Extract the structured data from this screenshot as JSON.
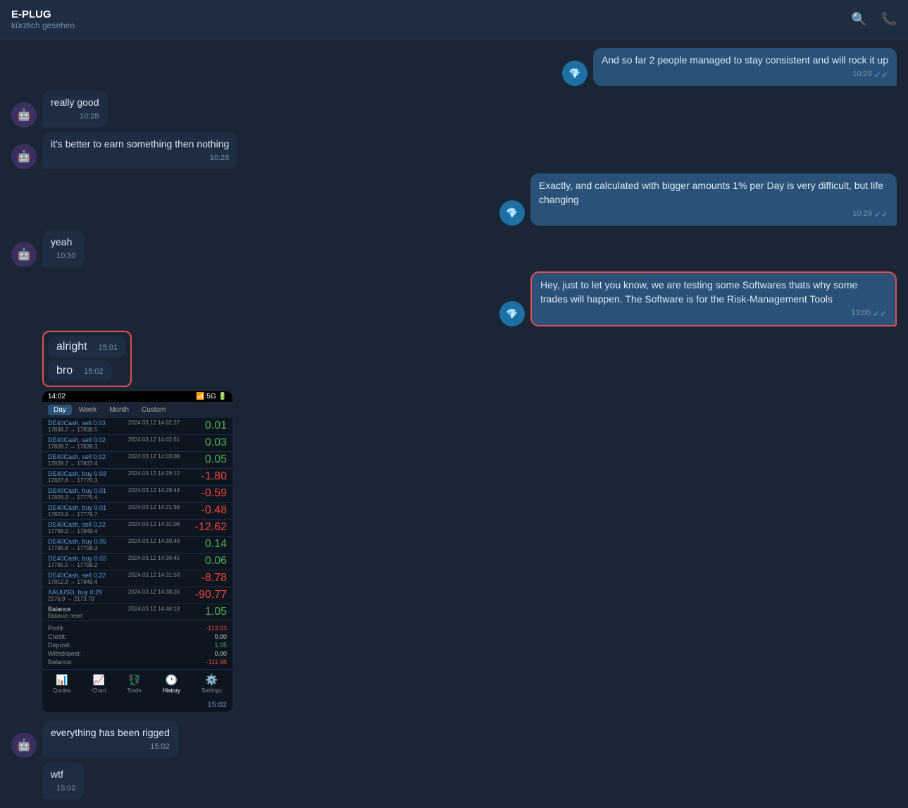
{
  "app": {
    "title": "E-PLUG",
    "subtitle": "kürzlich gesehen"
  },
  "header": {
    "search_icon": "🔍",
    "call_icon": "📞"
  },
  "messages": [
    {
      "id": "msg1",
      "type": "outgoing",
      "avatar": "diamond",
      "text": "And so far 2 people managed to stay consistent and will rock it up",
      "time": "10:26",
      "read": true
    },
    {
      "id": "msg2",
      "type": "incoming",
      "avatar": "dark",
      "text": "really good",
      "time": "10:28"
    },
    {
      "id": "msg3",
      "type": "incoming",
      "avatar": "dark",
      "text": "it's better to earn something then nothing",
      "time": "10:28"
    },
    {
      "id": "msg4",
      "type": "outgoing",
      "avatar": "diamond",
      "text": "Exactly, and calculated with bigger amounts 1% per Day is very difficult, but life changing",
      "time": "10:29",
      "read": true
    },
    {
      "id": "msg5",
      "type": "incoming",
      "avatar": "dark",
      "text": "yeah",
      "time": "10:30"
    },
    {
      "id": "msg6",
      "type": "outgoing",
      "avatar": "diamond",
      "text": "Hey, just to let you know, we are testing some Softwares thats why some trades will happen. The Software is for the Risk-Management Tools",
      "time": "13:00",
      "read": true,
      "highlighted": true
    },
    {
      "id": "msg7",
      "type": "incoming",
      "text": "alright",
      "time": "15:01"
    },
    {
      "id": "msg8",
      "type": "incoming",
      "text": "bro",
      "time": "15:02"
    }
  ],
  "screenshot": {
    "time_display": "14:02",
    "tabs": [
      "Day",
      "Week",
      "Month",
      "Custom"
    ],
    "active_tab": "Day",
    "trades": [
      {
        "pair": "DE40Cash, sell 0.03",
        "price_from": "17838.7",
        "price_to": "17838.5",
        "date": "2024.03.12 14:02:27",
        "pl": "0.01",
        "pl_type": "pos"
      },
      {
        "pair": "DE40Cash, sell 0.02",
        "price_from": "17839.7",
        "price_to": "17838.3",
        "date": "2024.03.12 14:02:51",
        "pl": "0.03",
        "pl_type": "pos"
      },
      {
        "pair": "DE40Cash, sell 0.02",
        "price_from": "17839.7",
        "price_to": "17837.4",
        "date": "2024.03.12 14:03:08",
        "pl": "0.05",
        "pl_type": "pos"
      },
      {
        "pair": "DE40Cash, buy 0.03",
        "price_from": "17827.8",
        "price_to": "17770.3",
        "date": "2024.03.12 14:29:12",
        "pl": "-1.80",
        "pl_type": "neg"
      },
      {
        "pair": "DE40Cash, buy 0.01",
        "price_from": "17826.3",
        "price_to": "17775.4",
        "date": "2024.03.12 14:29:44",
        "pl": "-0.59",
        "pl_type": "neg"
      },
      {
        "pair": "DE40Cash, buy 0.01",
        "price_from": "17823.9",
        "price_to": "17779.7",
        "date": "2024.03.12 14:21:58",
        "pl": "-0.48",
        "pl_type": "neg"
      },
      {
        "pair": "DE40Cash, sell 0.22",
        "price_from": "17798.0",
        "price_to": "17849.4",
        "date": "2024.03.12 14:31:06",
        "pl": "-12.62",
        "pl_type": "neg"
      },
      {
        "pair": "DE40Cash, buy 0.05",
        "price_from": "17795.8",
        "price_to": "17798.3",
        "date": "2024.03.12 14:30:48",
        "pl": "0.14",
        "pl_type": "pos"
      },
      {
        "pair": "DE40Cash, buy 0.02",
        "price_from": "17795.5",
        "price_to": "17798.2",
        "date": "2024.03.12 14:30:45",
        "pl": "0.06",
        "pl_type": "pos"
      },
      {
        "pair": "DE40Cash, sell 0.22",
        "price_from": "17812.9",
        "price_to": "17849.4",
        "date": "2024.03.12 14:31:58",
        "pl": "-8.78",
        "pl_type": "neg"
      },
      {
        "pair": "XAUUSD, buy 0.29",
        "price_from": "2176.9",
        "price_to": "2173.79",
        "date": "2024.03.12 14:38:36",
        "pl": "-90.77",
        "pl_type": "neg"
      },
      {
        "pair": "Balance",
        "price_from": "",
        "price_to": "",
        "date": "2024.03.12 14:40:18",
        "pl": "1.05",
        "pl_type": "pos"
      }
    ],
    "summary": {
      "balance_reset": "1.05",
      "profit": "-113.03",
      "credit": "0.00",
      "deposit": "1.05",
      "withdrawal": "0.00",
      "balance": "-111.98"
    },
    "bottom_tabs": [
      "Quotes",
      "Chart",
      "Trade",
      "History",
      "Settings"
    ],
    "active_bottom": "History",
    "bottom_time": "15:02"
  },
  "bottom_messages": [
    {
      "id": "bmsg1",
      "type": "incoming",
      "avatar": "dark",
      "text": "everything has been rigged",
      "time": "15:02"
    },
    {
      "id": "bmsg2",
      "type": "incoming",
      "text": "wtf",
      "time": "15:02"
    }
  ]
}
